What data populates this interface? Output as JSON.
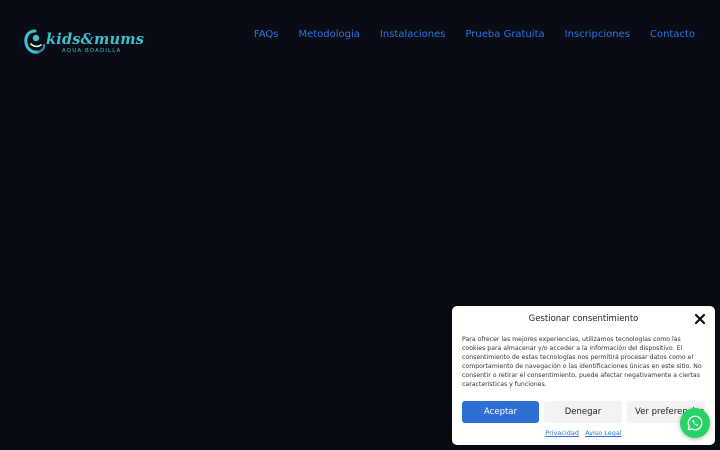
{
  "brand": {
    "name": "kids&mums",
    "subtitle": "AQUA BOADILLA",
    "accent_color": "#3ec1cf"
  },
  "nav": {
    "items": [
      {
        "label": "FAQs"
      },
      {
        "label": "Metodologia"
      },
      {
        "label": "Instalaciones"
      },
      {
        "label": "Prueba Gratuita"
      },
      {
        "label": "Inscripciones"
      },
      {
        "label": "Contacto"
      }
    ],
    "link_color": "#2f73e6"
  },
  "consent": {
    "title": "Gestionar consentimiento",
    "body": "Para ofrecer las mejores experiencias, utilizamos tecnologías como las cookies para almacenar y/o acceder a la información del dispositivo. El consentimiento de estas tecnologías nos permitirá procesar datos como el comportamiento de navegación o las identificaciones únicas en este sitio. No consentir o retirar el consentimiento, puede afectar negativamente a ciertas características y funciones.",
    "accept_label": "Aceptar",
    "deny_label": "Denegar",
    "prefs_label": "Ver preferencias",
    "links": [
      {
        "label": "Privacidad"
      },
      {
        "label": "Aviso Legal"
      }
    ],
    "accept_color": "#2e6fd4"
  },
  "whatsapp": {
    "icon": "whatsapp-icon",
    "color": "#25d366"
  },
  "page": {
    "background": "#090c14"
  }
}
